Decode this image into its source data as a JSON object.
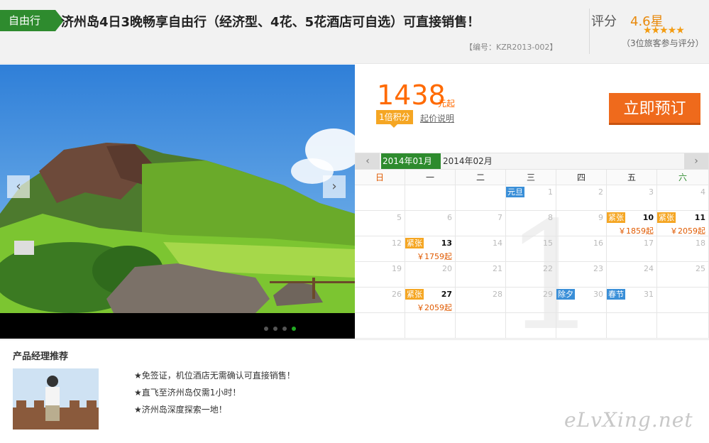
{
  "header": {
    "tag": "自由行",
    "title": "济州岛4日3晚畅享自由行（经济型、4花、5花酒店可自选）可直接销售！",
    "code": "【编号：KZR2013-002】",
    "rating_label": "评分",
    "rating_value": "4.6星",
    "stars": "★★★★★",
    "review_count": "（3位旅客参与评分）"
  },
  "gallery": {
    "prev": "‹",
    "next": "›",
    "dots": 4,
    "active_dot": 4
  },
  "price": {
    "amount": "1438",
    "unit": "元起",
    "points": "1倍积分",
    "note": "起价说明",
    "book_button": "立即预订"
  },
  "calendar": {
    "prev": "‹",
    "next": "›",
    "months": [
      "2014年01月",
      "2014年02月"
    ],
    "weekdays": [
      "日",
      "一",
      "二",
      "三",
      "四",
      "五",
      "六"
    ],
    "watermark_number": "1",
    "weeks": [
      [
        {
          "d": ""
        },
        {
          "d": ""
        },
        {
          "d": ""
        },
        {
          "d": "1",
          "badge": "元旦",
          "badge_type": "holiday"
        },
        {
          "d": "2"
        },
        {
          "d": "3"
        },
        {
          "d": "4"
        }
      ],
      [
        {
          "d": "5"
        },
        {
          "d": "6"
        },
        {
          "d": "7"
        },
        {
          "d": "8"
        },
        {
          "d": "9"
        },
        {
          "d": "10",
          "badge": "紧张",
          "badge_type": "hot",
          "price": "￥1859起",
          "bold": true
        },
        {
          "d": "11",
          "badge": "紧张",
          "badge_type": "hot",
          "price": "￥2059起",
          "bold": true
        }
      ],
      [
        {
          "d": "12"
        },
        {
          "d": "13",
          "badge": "紧张",
          "badge_type": "hot",
          "price": "￥1759起",
          "bold": true
        },
        {
          "d": "14"
        },
        {
          "d": "15"
        },
        {
          "d": "16"
        },
        {
          "d": "17"
        },
        {
          "d": "18"
        }
      ],
      [
        {
          "d": "19"
        },
        {
          "d": "20"
        },
        {
          "d": "21"
        },
        {
          "d": "22"
        },
        {
          "d": "23"
        },
        {
          "d": "24"
        },
        {
          "d": "25"
        }
      ],
      [
        {
          "d": "26"
        },
        {
          "d": "27",
          "badge": "紧张",
          "badge_type": "hot",
          "price": "￥2059起",
          "bold": true
        },
        {
          "d": "28"
        },
        {
          "d": "29"
        },
        {
          "d": "30",
          "badge": "除夕",
          "badge_type": "holiday"
        },
        {
          "d": "31",
          "badge": "春节",
          "badge_type": "holiday"
        },
        {
          "d": ""
        }
      ],
      [
        {
          "d": ""
        },
        {
          "d": ""
        },
        {
          "d": ""
        },
        {
          "d": ""
        },
        {
          "d": ""
        },
        {
          "d": ""
        },
        {
          "d": ""
        }
      ]
    ]
  },
  "recommend": {
    "title": "产品经理推荐",
    "items": [
      "★免签证，机位酒店无需确认可直接销售！",
      "★直飞至济州岛仅需1小时！",
      "★济州岛深度探索一地！"
    ],
    "watermark": "eLvXing.net"
  },
  "colors": {
    "green": "#2e8b2e",
    "orange": "#ef6a1c",
    "price": "#ff6a00",
    "hot": "#f5a623",
    "holiday": "#3a8fd8"
  }
}
